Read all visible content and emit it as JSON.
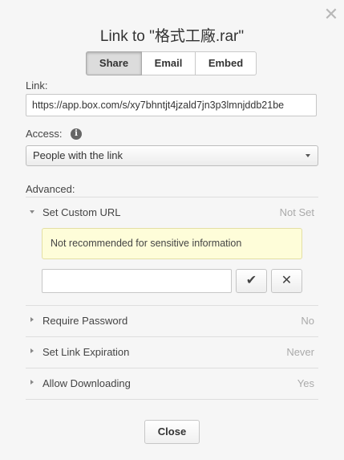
{
  "dialog": {
    "close_glyph": "✕",
    "title": "Link to \"格式工廠.rar\""
  },
  "tabs": [
    {
      "label": "Share",
      "active": true
    },
    {
      "label": "Email",
      "active": false
    },
    {
      "label": "Embed",
      "active": false
    }
  ],
  "link": {
    "label": "Link:",
    "url": "https://app.box.com/s/xy7bhntjt4jzald7jn3p3lmnjddb21be"
  },
  "access": {
    "label": "Access:",
    "info_glyph": "i",
    "selected": "People with the link"
  },
  "advanced": {
    "label": "Advanced:",
    "custom_url": {
      "label": "Set Custom URL",
      "value": "Not Set",
      "expanded": true
    },
    "warning": "Not recommended for sensitive information",
    "custom_input_value": "",
    "confirm_glyph": "✔",
    "cancel_glyph": "✕",
    "options": [
      {
        "label": "Require Password",
        "value": "No"
      },
      {
        "label": "Set Link Expiration",
        "value": "Never"
      },
      {
        "label": "Allow Downloading",
        "value": "Yes"
      }
    ]
  },
  "footer": {
    "close_label": "Close"
  }
}
